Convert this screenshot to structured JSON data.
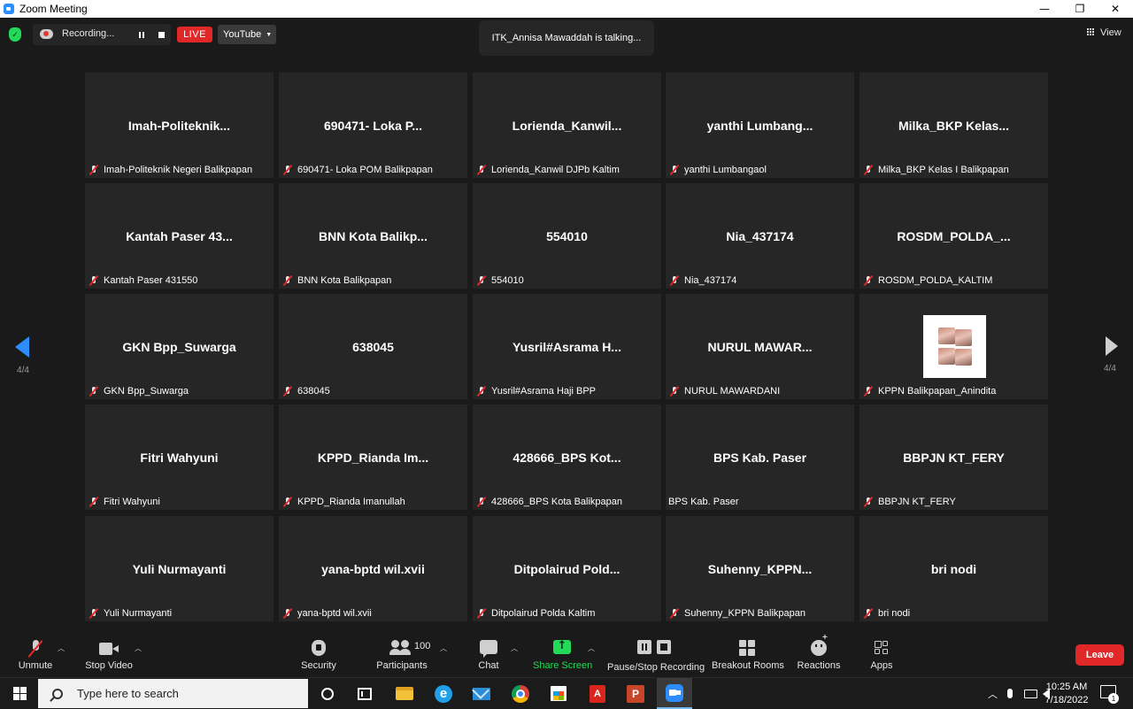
{
  "window": {
    "title": "Zoom Meeting",
    "min": "—",
    "max": "❐",
    "close": "✕"
  },
  "topbar": {
    "recording_label": "Recording...",
    "live_label": "LIVE",
    "stream_target": "YouTube",
    "talking": "ITK_Annisa Mawaddah is talking...",
    "view_label": "View"
  },
  "pager": {
    "left": "4/4",
    "right": "4/4"
  },
  "tiles": [
    {
      "big": "Imah-Politeknik...",
      "label": "Imah-Politeknik Negeri Balikpapan",
      "muted": true
    },
    {
      "big": "690471- Loka P...",
      "label": "690471- Loka POM Balikpapan",
      "muted": true
    },
    {
      "big": "Lorienda_Kanwil...",
      "label": "Lorienda_Kanwil DJPb Kaltim",
      "muted": true
    },
    {
      "big": "yanthi  Lumbang...",
      "label": "yanthi Lumbangaol",
      "muted": true
    },
    {
      "big": "Milka_BKP  Kelas...",
      "label": "Milka_BKP Kelas I Balikpapan",
      "muted": true
    },
    {
      "big": "Kantah Paser 43...",
      "label": "Kantah Paser 431550",
      "muted": true
    },
    {
      "big": "BNN  Kota  Balikp...",
      "label": "BNN Kota Balikpapan",
      "muted": true
    },
    {
      "big": "554010",
      "label": "554010",
      "muted": true
    },
    {
      "big": "Nia_437174",
      "label": "Nia_437174",
      "muted": true
    },
    {
      "big": "ROSDM_POLDA_...",
      "label": "ROSDM_POLDA_KALTIM",
      "muted": true
    },
    {
      "big": "GKN Bpp_Suwarga",
      "label": "GKN Bpp_Suwarga",
      "muted": true
    },
    {
      "big": "638045",
      "label": "638045",
      "muted": true
    },
    {
      "big": "Yusril#Asrama  H...",
      "label": "Yusril#Asrama Haji BPP",
      "muted": true
    },
    {
      "big": "NURUL  MAWAR...",
      "label": "NURUL MAWARDANI",
      "muted": true
    },
    {
      "big": "",
      "label": "KPPN Balikpapan_Anindita",
      "muted": true
    },
    {
      "big": "Fitri Wahyuni",
      "label": "Fitri Wahyuni",
      "muted": true
    },
    {
      "big": "KPPD_Rianda  Im...",
      "label": "KPPD_Rianda Imanullah",
      "muted": true
    },
    {
      "big": "428666_BPS  Kot...",
      "label": "428666_BPS Kota Balikpapan",
      "muted": true
    },
    {
      "big": "BPS Kab. Paser",
      "label": "BPS Kab. Paser",
      "muted": false
    },
    {
      "big": "BBPJN KT_FERY",
      "label": "BBPJN KT_FERY",
      "muted": true
    },
    {
      "big": "Yuli Nurmayanti",
      "label": "Yuli Nurmayanti",
      "muted": true
    },
    {
      "big": "yana-bptd wil.xvii",
      "label": "yana-bptd wil.xvii",
      "muted": true
    },
    {
      "big": "Ditpolairud  Pold...",
      "label": "Ditpolairud Polda Kaltim",
      "muted": true
    },
    {
      "big": "Suhenny_KPPN...",
      "label": "Suhenny_KPPN Balikpapan",
      "muted": true
    },
    {
      "big": "bri nodi",
      "label": "bri nodi",
      "muted": true
    }
  ],
  "toolbar": {
    "unmute": "Unmute",
    "stop_video": "Stop Video",
    "security": "Security",
    "participants": "Participants",
    "participants_count": "100",
    "chat": "Chat",
    "share_screen": "Share Screen",
    "pause_stop_recording": "Pause/Stop Recording",
    "breakout_rooms": "Breakout Rooms",
    "reactions": "Reactions",
    "apps": "Apps",
    "leave": "Leave"
  },
  "taskbar": {
    "search_placeholder": "Type here to search",
    "time": "10:25 AM",
    "date": "7/18/2022",
    "notification_count": "1"
  },
  "colors": {
    "accent_blue": "#2d8cff",
    "share_green": "#23d959",
    "live_red": "#e02828",
    "tile_bg": "#262626"
  }
}
